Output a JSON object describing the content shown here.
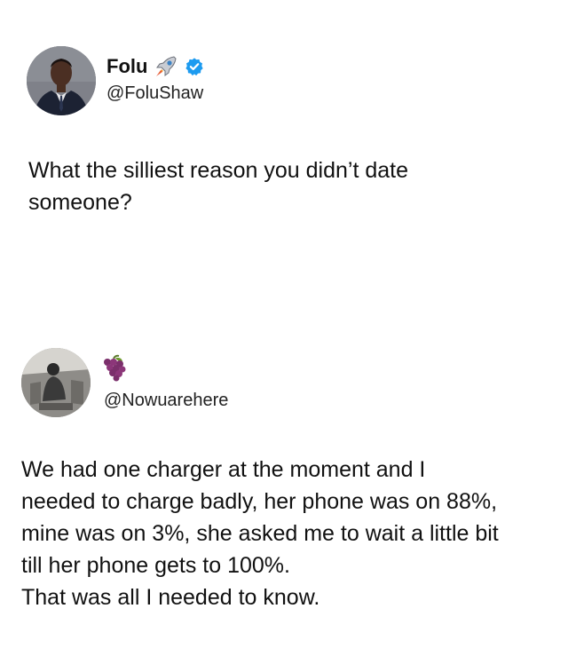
{
  "tweet": {
    "author_name": "Folu",
    "author_handle": "@FoluShaw",
    "author_emoji_icon": "rocket-icon",
    "verified_icon": "verified-badge-icon",
    "verified_color": "#1d9bf0",
    "text": "What the silliest reason you didn’t date\nsomeone?"
  },
  "reply": {
    "author_emoji_icon": "grapes-icon",
    "author_handle": "@Nowuarehere",
    "text": "We had one charger at the moment and I\nneeded to charge badly, her phone was on 88%,\nmine was on 3%, she asked me to wait a little bit\ntill her phone gets to 100%.\nThat was all I needed to know."
  }
}
